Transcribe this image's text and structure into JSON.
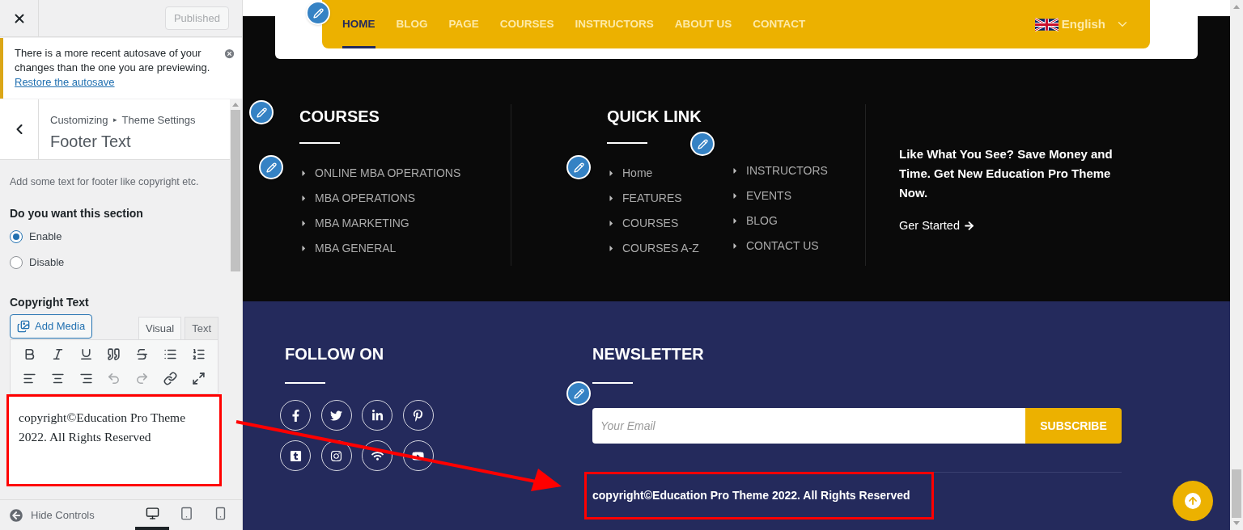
{
  "customizer": {
    "publish_button": {
      "label": "Published",
      "disabled": true
    },
    "notice": {
      "text": "There is a more recent autosave of your changes than the one you are previewing.",
      "link": "Restore the autosave"
    },
    "breadcrumb": [
      "Customizing",
      "Theme Settings"
    ],
    "breadcrumb_separator": "▸",
    "title": "Footer Text",
    "description": "Add some text for footer like copyright etc.",
    "section_label": "Do you want this section",
    "options": [
      {
        "label": "Enable",
        "selected": true
      },
      {
        "label": "Disable",
        "selected": false
      }
    ],
    "copyright_label": "Copyright Text",
    "add_media": "Add Media",
    "editor_tabs": [
      {
        "label": "Visual",
        "selected": true
      },
      {
        "label": "Text",
        "selected": false
      }
    ],
    "toolbar": [
      {
        "kind": "bold",
        "disabled": false
      },
      {
        "kind": "italic",
        "disabled": false
      },
      {
        "kind": "underline",
        "disabled": false
      },
      {
        "kind": "quote",
        "disabled": false
      },
      {
        "kind": "strikethrough",
        "disabled": false
      },
      {
        "kind": "bullets",
        "disabled": false
      },
      {
        "kind": "numbers",
        "disabled": false
      },
      {
        "kind": "align-left",
        "disabled": false
      },
      {
        "kind": "align-center",
        "disabled": false
      },
      {
        "kind": "align-right",
        "disabled": false
      },
      {
        "kind": "undo",
        "disabled": true
      },
      {
        "kind": "redo",
        "disabled": true
      },
      {
        "kind": "link",
        "disabled": false
      },
      {
        "kind": "fullscreen",
        "disabled": false
      }
    ],
    "editor_text": "copyright©Education Pro Theme 2022. All Rights Reserved",
    "hide_controls": "Hide Controls",
    "devices": [
      {
        "kind": "desktop",
        "selected": true
      },
      {
        "kind": "tablet",
        "selected": false
      },
      {
        "kind": "mobile",
        "selected": false
      }
    ]
  },
  "preview": {
    "nav": [
      {
        "label": "HOME",
        "selected": true
      },
      {
        "label": "BLOG",
        "selected": false
      },
      {
        "label": "PAGE",
        "selected": false
      },
      {
        "label": "COURSES",
        "selected": false
      },
      {
        "label": "INSTRUCTORS",
        "selected": false
      },
      {
        "label": "ABOUT US",
        "selected": false
      },
      {
        "label": "CONTACT",
        "selected": false
      }
    ],
    "language": "English",
    "courses": {
      "title": "COURSES",
      "items": [
        "ONLINE MBA OPERATIONS",
        "MBA OPERATIONS",
        "MBA MARKETING",
        "MBA GENERAL"
      ]
    },
    "quick_link": {
      "title": "QUICK LINK",
      "columns": [
        [
          "Home",
          "FEATURES",
          "COURSES",
          "COURSES A-Z"
        ],
        [
          "INSTRUCTORS",
          "EVENTS",
          "BLOG",
          "CONTACT US"
        ]
      ]
    },
    "promo": {
      "text": "Like What You See? Save Money and Time. Get New Education Pro Theme Now.",
      "link": "Ger Started"
    },
    "follow": {
      "title": "FOLLOW ON",
      "icons": [
        {
          "kind": "facebook"
        },
        {
          "kind": "twitter"
        },
        {
          "kind": "linkedin"
        },
        {
          "kind": "pinterest"
        },
        {
          "kind": "tumblr"
        },
        {
          "kind": "instagram"
        },
        {
          "kind": "feed"
        },
        {
          "kind": "youtube"
        }
      ]
    },
    "newsletter": {
      "title": "NEWSLETTER",
      "placeholder": "Your Email",
      "button": "SUBSCRIBE"
    },
    "copyright": "copyright©Education Pro Theme 2022. All Rights Reserved"
  }
}
